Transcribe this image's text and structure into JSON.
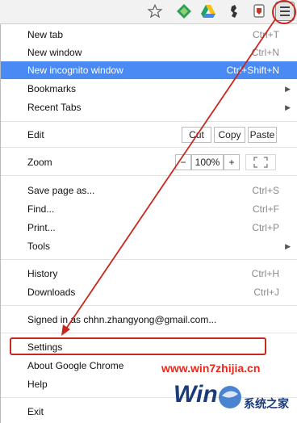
{
  "toolbar": {
    "icons": [
      "star-icon",
      "extension-diamond-icon",
      "drive-icon",
      "puzzle-icon",
      "shield-icon",
      "menu-icon"
    ]
  },
  "menu": {
    "new_tab": {
      "label": "New tab",
      "shortcut": "Ctrl+T"
    },
    "new_window": {
      "label": "New window",
      "shortcut": "Ctrl+N"
    },
    "new_incognito": {
      "label": "New incognito window",
      "shortcut": "Ctrl+Shift+N"
    },
    "bookmarks": {
      "label": "Bookmarks"
    },
    "recent_tabs": {
      "label": "Recent Tabs"
    },
    "edit": {
      "label": "Edit",
      "cut": "Cut",
      "copy": "Copy",
      "paste": "Paste"
    },
    "zoom": {
      "label": "Zoom",
      "minus": "−",
      "value": "100%",
      "plus": "+"
    },
    "save_page": {
      "label": "Save page as...",
      "shortcut": "Ctrl+S"
    },
    "find": {
      "label": "Find...",
      "shortcut": "Ctrl+F"
    },
    "print": {
      "label": "Print...",
      "shortcut": "Ctrl+P"
    },
    "tools": {
      "label": "Tools"
    },
    "history": {
      "label": "History",
      "shortcut": "Ctrl+H"
    },
    "downloads": {
      "label": "Downloads",
      "shortcut": "Ctrl+J"
    },
    "signed_in": {
      "label": "Signed in as chhn.zhangyong@gmail.com..."
    },
    "settings": {
      "label": "Settings"
    },
    "about": {
      "label": "About Google Chrome"
    },
    "help": {
      "label": "Help"
    },
    "exit": {
      "label": "Exit"
    }
  },
  "watermark": {
    "site": "www.win7zhijia.cn",
    "brand": "系统之家"
  },
  "colors": {
    "highlight": "#4a8af4",
    "annotation_red": "#c7281e"
  }
}
